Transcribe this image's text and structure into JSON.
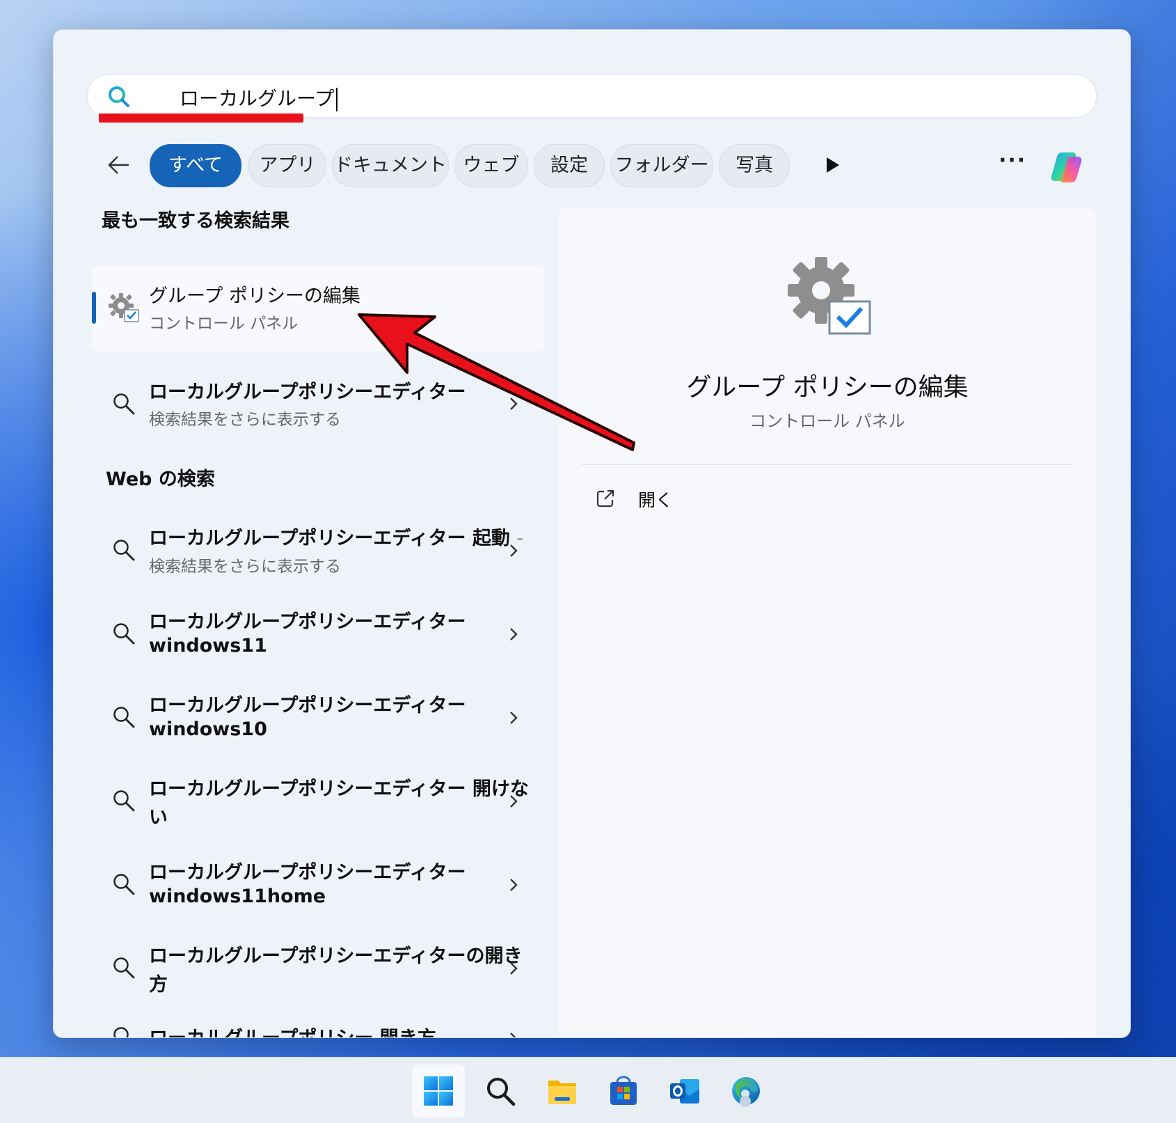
{
  "search": {
    "query": "ローカルグループ"
  },
  "filters": {
    "back_icon": "back-arrow-icon",
    "chips": [
      "すべて",
      "アプリ",
      "ドキュメント",
      "ウェブ",
      "設定",
      "フォルダー",
      "写真"
    ],
    "active": "すべて",
    "more_icon": "play-triangle-icon",
    "overflow_icon": "ellipsis-icon",
    "copilot_icon": "copilot-icon"
  },
  "best_match": {
    "heading": "最も一致する検索結果",
    "title": "グループ ポリシーの編集",
    "subtitle": "コントロール パネル",
    "icon": "gear-check-icon"
  },
  "more_result": {
    "title": "ローカルグループポリシーエディター",
    "subtitle": "検索結果をさらに表示する"
  },
  "web": {
    "heading": "Web の検索",
    "items": [
      {
        "line1": "ローカルグループポリシーエディター 起動",
        "dash": "-",
        "line2": "検索結果をさらに表示する"
      },
      {
        "line1": "ローカルグループポリシーエディター",
        "line2": "windows11"
      },
      {
        "line1": "ローカルグループポリシーエディター",
        "line2": "windows10"
      },
      {
        "line1": "ローカルグループポリシーエディター 開けな",
        "line2": "い"
      },
      {
        "line1": "ローカルグループポリシーエディター",
        "line2": "windows11home"
      },
      {
        "line1": "ローカルグループポリシーエディターの開き",
        "line2": "方"
      },
      {
        "line1": "ローカルグループポリシー 開き方"
      }
    ]
  },
  "detail": {
    "title": "グループ ポリシーの編集",
    "subtitle": "コントロール パネル",
    "open_label": "開く",
    "open_icon": "external-link-icon"
  },
  "taskbar": {
    "items": [
      "windows-start-icon",
      "search-icon",
      "file-explorer-icon",
      "microsoft-store-icon",
      "outlook-icon",
      "edge-icon"
    ]
  },
  "colors": {
    "accent": "#1664b8",
    "annotation_red": "#e8111b"
  }
}
